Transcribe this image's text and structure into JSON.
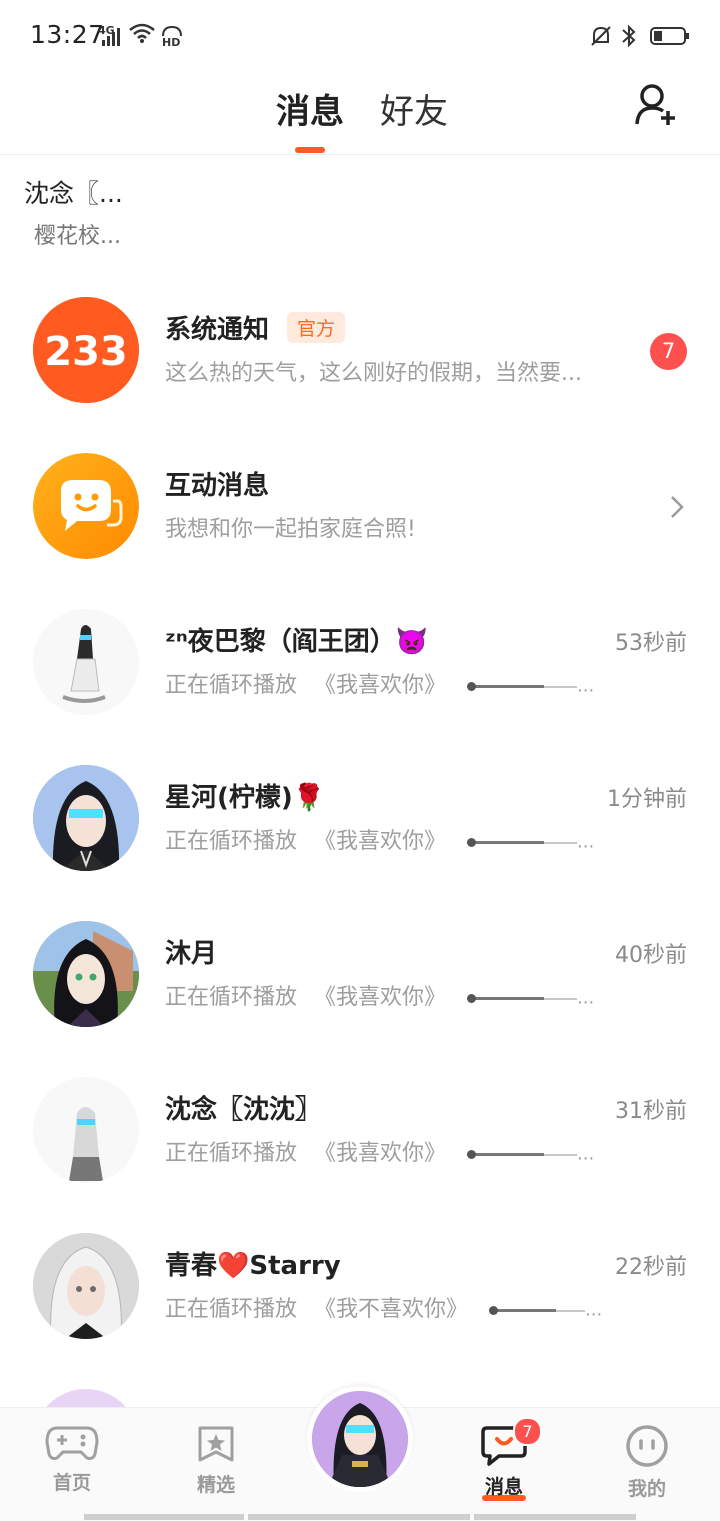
{
  "status_bar": {
    "time": "13:27",
    "network": "4G",
    "hd": "HD"
  },
  "header": {
    "tabs": [
      {
        "label": "消息",
        "active": true
      },
      {
        "label": "好友",
        "active": false
      }
    ],
    "add_friend_icon": "add-user-icon"
  },
  "top_user": {
    "name": "沈念〖...",
    "subtitle": "樱花校..."
  },
  "system": {
    "title": "系统通知",
    "official_badge": "官方",
    "avatar_text": "233",
    "preview": "这么热的天气，这么刚好的假期，当然要...",
    "unread": "7"
  },
  "interaction": {
    "title": "互动消息",
    "preview": "我想和你一起拍家庭合照!"
  },
  "chats": [
    {
      "name": "ᶻⁿ夜巴黎（阎王团）👿",
      "status": "正在循环播放",
      "song": "《我喜欢你》",
      "time": "53秒前"
    },
    {
      "name": "星河(柠檬)🌹",
      "status": "正在循环播放",
      "song": "《我喜欢你》",
      "time": "1分钟前"
    },
    {
      "name": "沐月",
      "status": "正在循环播放",
      "song": "《我喜欢你》",
      "time": "40秒前"
    },
    {
      "name": "沈念〖沈沈〗",
      "status": "正在循环播放",
      "song": "《我喜欢你》",
      "time": "31秒前"
    },
    {
      "name": "青春❤️Starry",
      "status": "正在循环播放",
      "song": "《我不喜欢你》",
      "time": "22秒前"
    }
  ],
  "song_progress": 0.68,
  "ellipsis": "...",
  "nav": {
    "items": [
      {
        "label": "首页"
      },
      {
        "label": "精选"
      },
      {
        "label": "消息",
        "badge": "7"
      },
      {
        "label": "我的"
      }
    ]
  },
  "colors": {
    "accent": "#ff5a1f",
    "badge_red": "#ff5050",
    "official_bg": "#ffeadd"
  }
}
